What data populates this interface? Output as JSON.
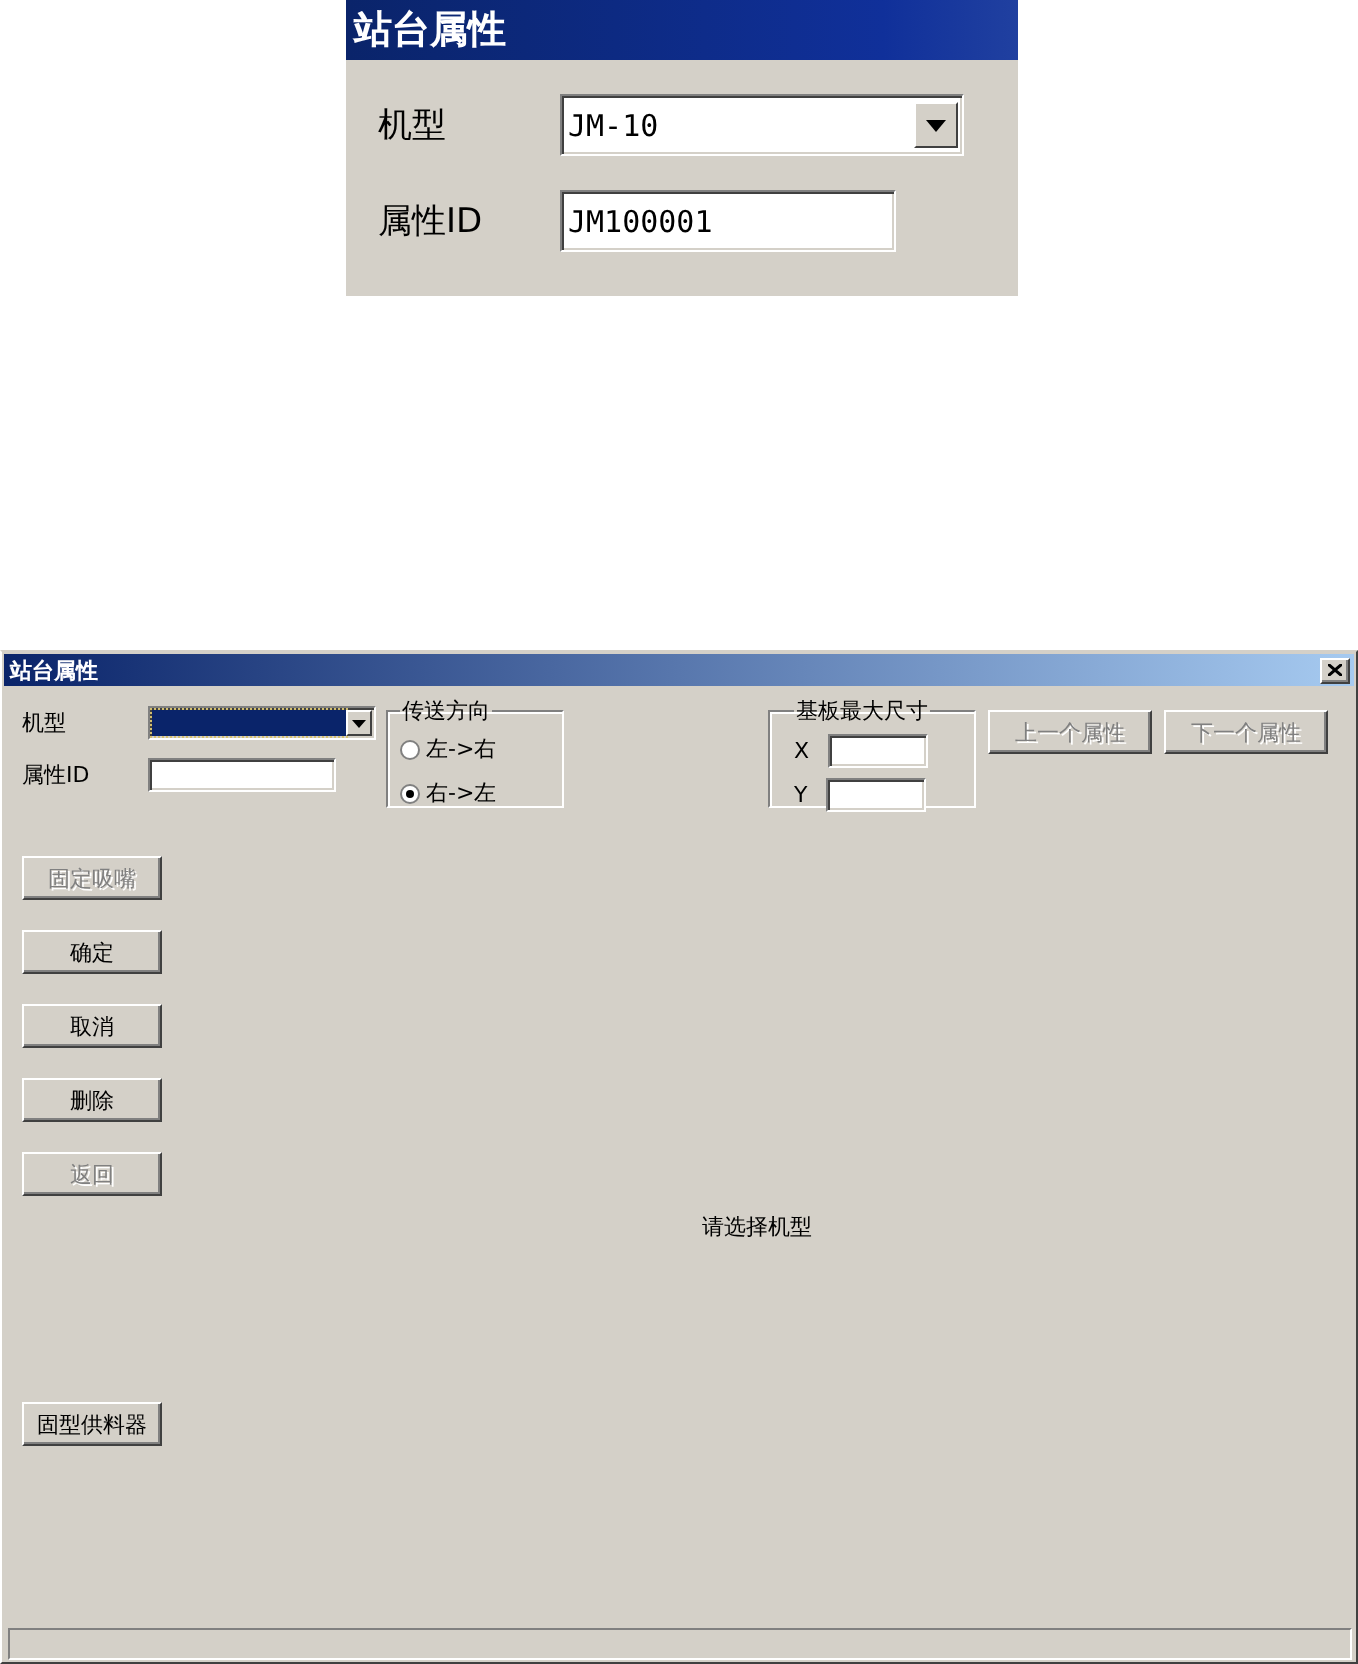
{
  "inset": {
    "title": "站台属性",
    "fields": [
      {
        "label": "机型",
        "kind": "dropdown",
        "value": "JM-10"
      },
      {
        "label": "属性ID",
        "kind": "text",
        "value": "JM100001"
      }
    ]
  },
  "dialog": {
    "title": "站台属性",
    "fields": [
      {
        "label": "机型",
        "kind": "dropdown",
        "focused": true
      },
      {
        "label": "属性ID",
        "kind": "text"
      }
    ],
    "direction": {
      "title": "传送方向",
      "options": [
        {
          "label": "左->右",
          "selected": false
        },
        {
          "label": "右->左",
          "selected": true
        }
      ]
    },
    "board_size": {
      "title": "基板最大尺寸",
      "fields": [
        {
          "label": "X"
        },
        {
          "label": "Y"
        }
      ]
    },
    "nav_buttons": [
      {
        "label": "上一个属性",
        "disabled": true
      },
      {
        "label": "下一个属性",
        "disabled": true
      }
    ],
    "side_buttons": [
      {
        "label": "固定吸嘴",
        "disabled": true
      },
      {
        "label": "确定",
        "disabled": false
      },
      {
        "label": "取消",
        "disabled": false
      },
      {
        "label": "删除",
        "disabled": false
      },
      {
        "label": "返回",
        "disabled": true
      }
    ],
    "bottom_buttons": [
      {
        "label": "固型供料器",
        "disabled": false
      }
    ],
    "message": "请选择机型"
  }
}
